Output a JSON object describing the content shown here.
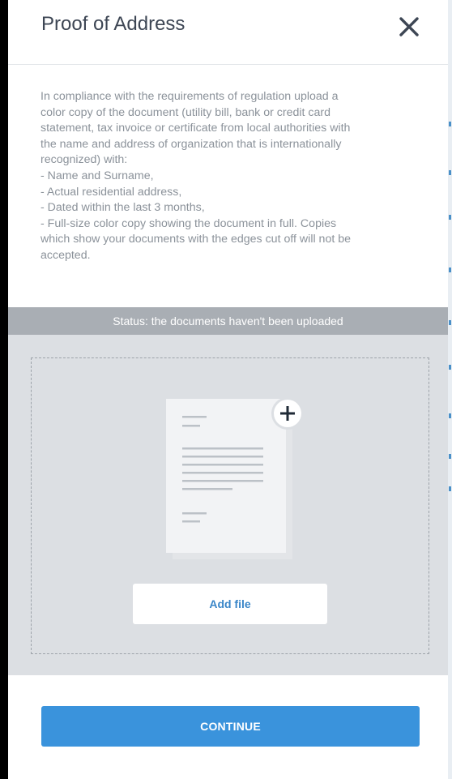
{
  "modal": {
    "title": "Proof of Address",
    "close_icon": "close-icon"
  },
  "description": {
    "lines": [
      "In compliance with the requirements of regulation upload a",
      "color copy of the document (utility bill, bank or credit card",
      "statement, tax invoice or certificate from local authorities with",
      "the name and address of organization that is internationally",
      "recognized) with:",
      "- Name and Surname,",
      "- Actual residential address,",
      "- Dated within the last 3 months,",
      "- Full-size color copy showing the document in full. Copies",
      "which show your documents with the edges cut off will not be",
      "accepted."
    ]
  },
  "status": {
    "text": "Status: the documents haven't been uploaded"
  },
  "upload": {
    "illustration_icon": "document-icon",
    "plus_icon": "plus-icon",
    "add_file_label": "Add file"
  },
  "footer": {
    "continue_label": "CONTINUE"
  },
  "colors": {
    "accent": "#3a93dc",
    "status_bar": "#a9aeb4",
    "upload_bg": "#dcdfe3",
    "title_text": "#3d4654",
    "body_text": "#8b929a"
  }
}
